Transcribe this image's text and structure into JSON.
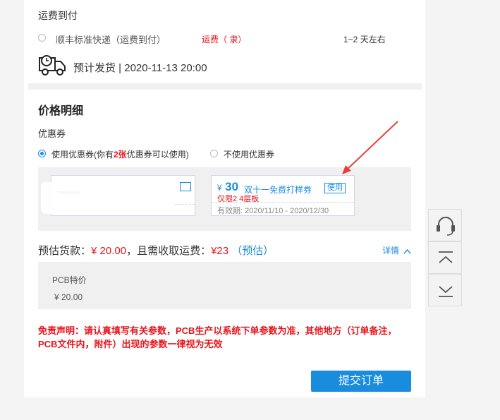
{
  "shipping": {
    "section_title": "运费到付",
    "option_label": "顺丰标准快递（运费到付）",
    "fee_text": "运费（ 隶）",
    "duration": "1~2 天左右",
    "estimated_ship": "预计发货 | 2020-11-13 20:00"
  },
  "price": {
    "section_title": "价格明细",
    "coupon_title": "优惠券",
    "use_coupon_prefix": "使用优惠券(你有",
    "coupon_count": "2张",
    "use_coupon_suffix": "优惠券可以使用)",
    "no_coupon_label": "不使用优惠券",
    "coupon": {
      "currency": "¥",
      "amount": "30",
      "name": "双十一免费打样券",
      "use_label": "使用",
      "limit": "仅限2 4层板",
      "validity": "有效期: 2020/11/10 - 2020/12/30"
    },
    "estimate_prefix": "预估货款：",
    "estimate_amount": "¥ 20.00",
    "estimate_middle": "，且需收取运费：",
    "shipping_amount": "¥23",
    "estimate_note": "（预估）",
    "details_label": "详情",
    "detail_item_label": "PCB特价",
    "detail_item_amount": "¥ 20.00"
  },
  "disclaimer": "免责声明：请认真填写有关参数，PCB生产以系统下单参数为准，其他地方（订单备注，PCB文件内，附件）出现的参数一律视为无效",
  "submit_label": "提交订单",
  "colors": {
    "accent": "#1a8cde",
    "danger": "#e8131b",
    "arrow": "#e8403a"
  },
  "side_icons": [
    "headset-icon",
    "back-to-top-icon",
    "scroll-bottom-icon"
  ]
}
